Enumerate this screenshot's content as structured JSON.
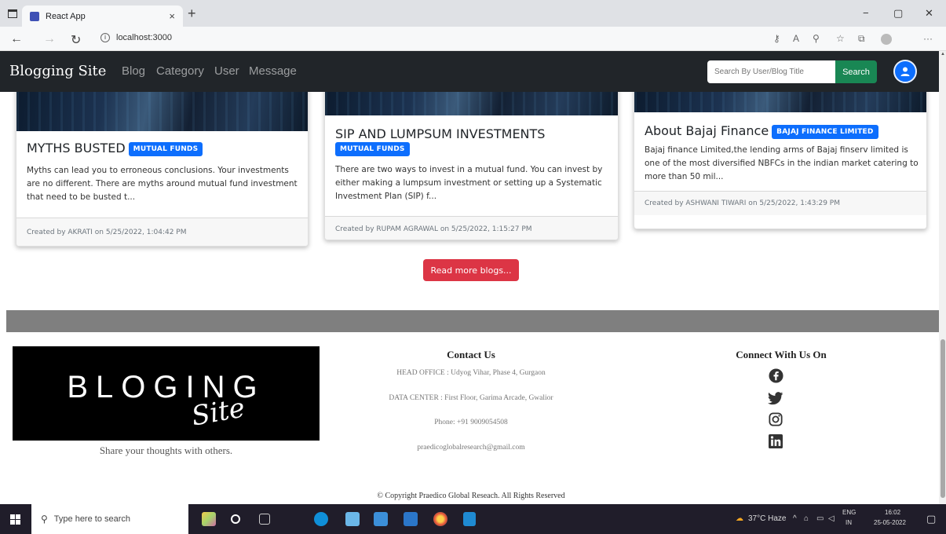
{
  "browser": {
    "tab_title": "React App",
    "tab_close": "×",
    "new_tab": "+",
    "url": "localhost:3000",
    "window_controls": [
      "−",
      "▢",
      "✕"
    ]
  },
  "navbar": {
    "brand": "Blogging Site",
    "links": [
      "Blog",
      "Category",
      "User",
      "Message"
    ],
    "search_placeholder": "Search By User/Blog Title",
    "search_button": "Search"
  },
  "cards": [
    {
      "title": "MYTHS BUSTED",
      "category": "MUTUAL FUNDS",
      "excerpt": "Myths can lead you to erroneous conclusions. Your investments are no different. There are myths around mutual fund investment that need to be busted t...",
      "footer": "Created by AKRATI on 5/25/2022, 1:04:42 PM"
    },
    {
      "title": "SIP AND LUMPSUM INVESTMENTS",
      "category": "MUTUAL FUNDS",
      "excerpt": "There are two ways to invest in a mutual fund. You can invest by either making a lumpsum investment or setting up a Systematic Investment Plan (SIP) f...",
      "footer": "Created by RUPAM AGRAWAL on 5/25/2022, 1:15:27 PM"
    },
    {
      "title": "About Bajaj Finance",
      "category": "BAJAJ FINANCE LIMITED",
      "excerpt": "Bajaj finance Limited,the lending arms of Bajaj finserv limited is one of the most diversified NBFCs in the indian market catering to more than 50 mil...",
      "footer": "Created by ASHWANI TIWARI on 5/25/2022, 1:43:29 PM"
    }
  ],
  "read_more": "Read more blogs...",
  "footer": {
    "logo_main": "BLOGING",
    "logo_script": "Site",
    "tagline": "Share your thoughts with others.",
    "contact_title": "Contact Us",
    "contact_lines": [
      "HEAD OFFICE : Udyog Vihar, Phase 4, Gurgaon",
      "DATA CENTER : First Floor, Garima Arcade, Gwalior",
      "Phone: +91 9009054508",
      "praedicoglobalresearch@gmail.com"
    ],
    "social_title": "Connect With Us On",
    "social_icons": [
      "facebook-icon",
      "twitter-icon",
      "instagram-icon",
      "linkedin-icon"
    ],
    "copyright": "© Copyright Praedico Global Reseach. All Rights Reserved"
  },
  "taskbar": {
    "search_placeholder": "Type here to search",
    "weather": "37°C Haze",
    "language": "ENG",
    "region": "IN",
    "time": "16:02",
    "date": "25-05-2022"
  },
  "colors": {
    "navbar_bg": "#212529",
    "search_green": "#198754",
    "badge_blue": "#0d6efd",
    "readmore_red": "#dc3545",
    "band_grey": "#7f7f7f"
  }
}
